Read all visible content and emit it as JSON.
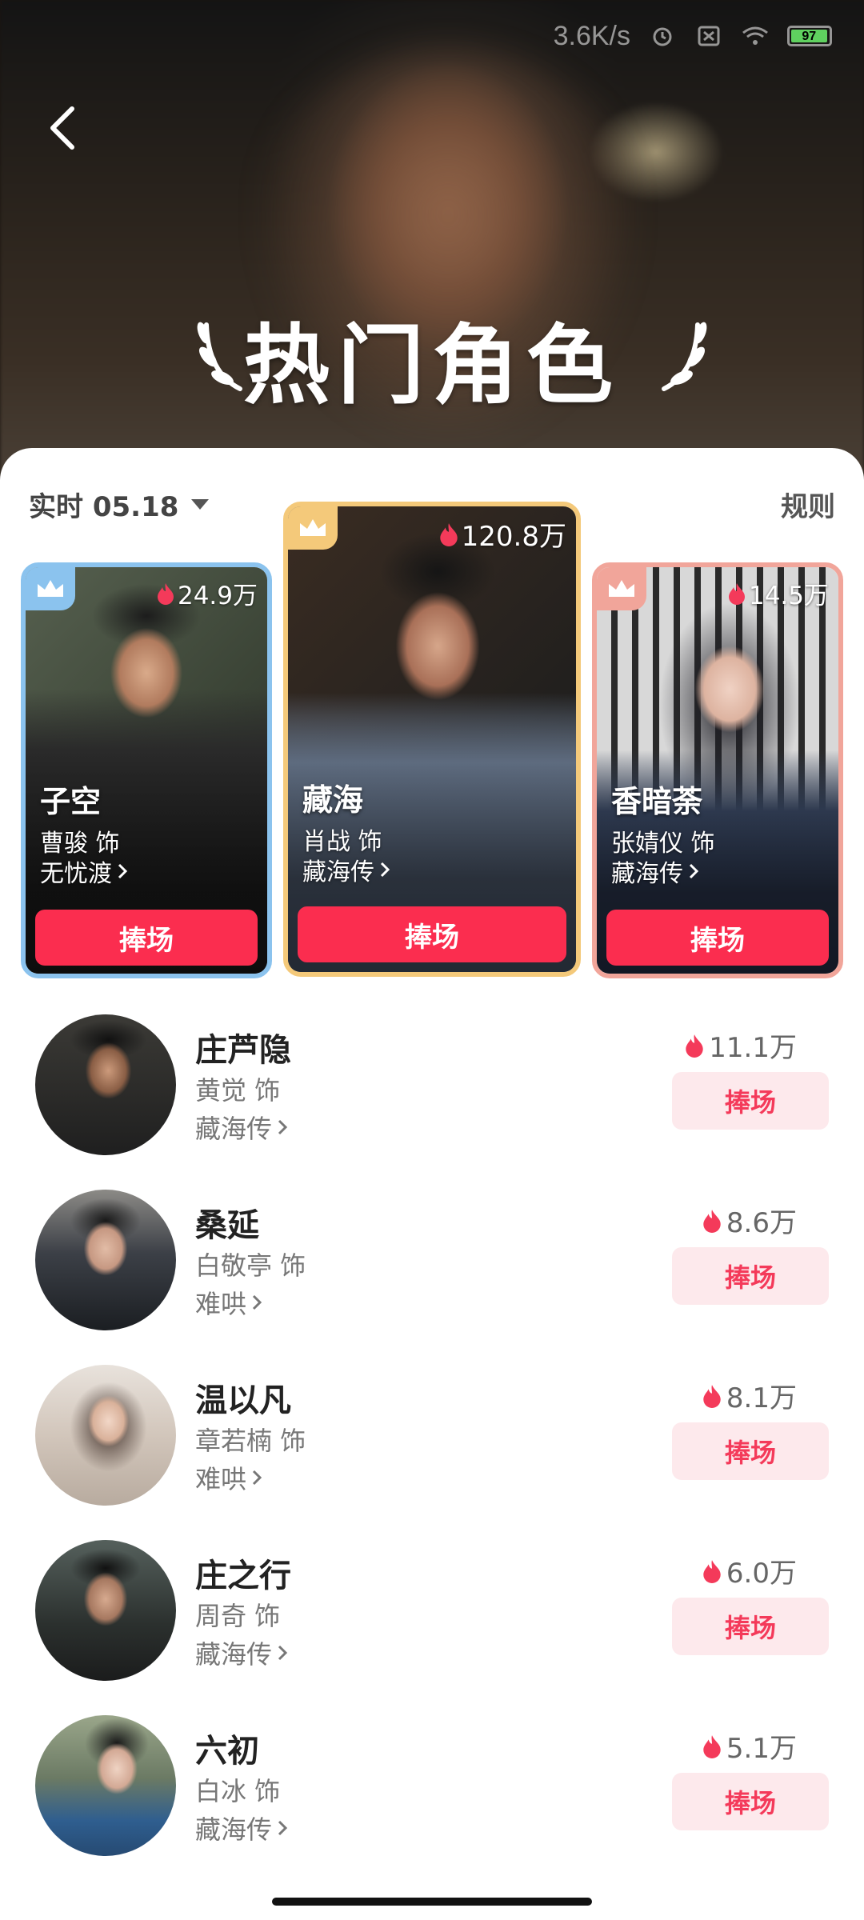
{
  "status_bar": {
    "net_speed": "3.6K/s",
    "battery": "97"
  },
  "header": {
    "title": "热门角色"
  },
  "filter": {
    "date_label": "实时 05.18",
    "rules_label": "规则"
  },
  "top3": [
    {
      "heat": "24.9万",
      "character": "子空",
      "actor": "曹骏 饰",
      "drama": "无忧渡",
      "button": "捧场"
    },
    {
      "heat": "120.8万",
      "character": "藏海",
      "actor": "肖战 饰",
      "drama": "藏海传",
      "button": "捧场"
    },
    {
      "heat": "14.5万",
      "character": "香暗荼",
      "actor": "张婧仪 饰",
      "drama": "藏海传",
      "button": "捧场"
    }
  ],
  "list": [
    {
      "character": "庄芦隐",
      "actor": "黄觉 饰",
      "drama": "藏海传",
      "heat": "11.1万",
      "button": "捧场"
    },
    {
      "character": "桑延",
      "actor": "白敬亭 饰",
      "drama": "难哄",
      "heat": "8.6万",
      "button": "捧场"
    },
    {
      "character": "温以凡",
      "actor": "章若楠 饰",
      "drama": "难哄",
      "heat": "8.1万",
      "button": "捧场"
    },
    {
      "character": "庄之行",
      "actor": "周奇 饰",
      "drama": "藏海传",
      "heat": "6.0万",
      "button": "捧场"
    },
    {
      "character": "六初",
      "actor": "白冰 饰",
      "drama": "藏海传",
      "heat": "5.1万",
      "button": "捧场"
    }
  ],
  "colors": {
    "accent": "#fb2d4f",
    "accent_soft": "#fde9ec",
    "flame": "#f43a5a",
    "rank1": "#f4c97a",
    "rank2": "#8bc3ee",
    "rank3": "#f1a59a"
  },
  "icons": {
    "back": "chevron-left-icon",
    "crown": "crown-icon",
    "heat": "flame-icon",
    "dropdown": "caret-down-icon",
    "drama_link": "chevron-right-icon"
  }
}
